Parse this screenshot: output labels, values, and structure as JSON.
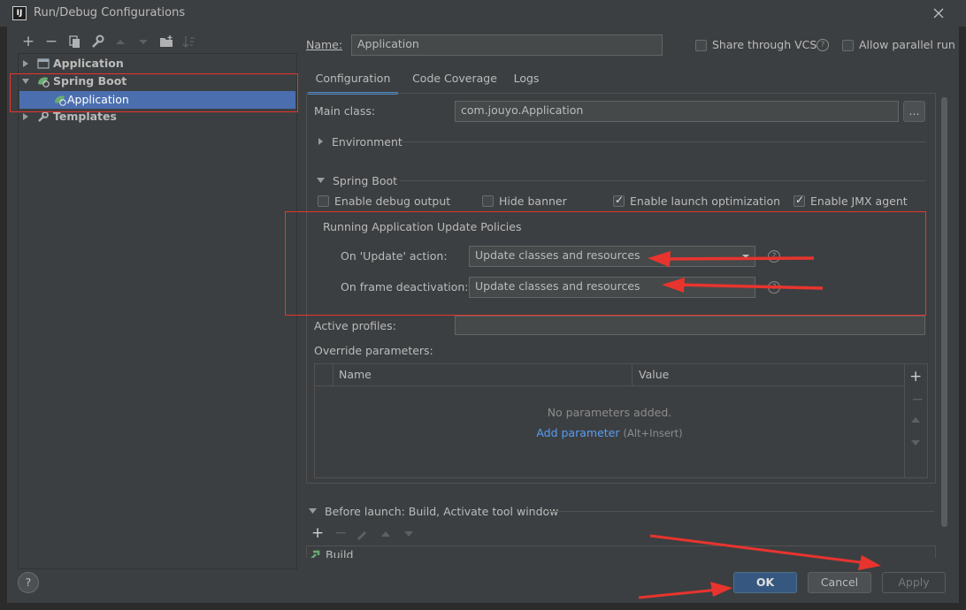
{
  "window": {
    "title": "Run/Debug Configurations",
    "app_icon_text": "IJ"
  },
  "toolbar_icons": [
    "add-icon",
    "remove-icon",
    "copy-icon",
    "wrench-icon",
    "move-up-icon",
    "move-down-icon",
    "new-folder-icon",
    "sort-icon"
  ],
  "tree": {
    "items": [
      {
        "label": "Application",
        "icon": "application-icon",
        "expanded": false
      },
      {
        "label": "Spring Boot",
        "icon": "spring-boot-icon",
        "expanded": true
      },
      {
        "label": "Application",
        "icon": "spring-boot-icon",
        "selected": true
      },
      {
        "label": "Templates",
        "icon": "wrench-icon",
        "expanded": false
      }
    ]
  },
  "header": {
    "name_label": "Name:",
    "name_value": "Application",
    "share_vcs_label": "Share through VCS",
    "allow_parallel_label": "Allow parallel run"
  },
  "tabs": [
    "Configuration",
    "Code Coverage",
    "Logs"
  ],
  "config": {
    "main_class_label": "Main class:",
    "main_class_value": "com.jouyo.Application",
    "browse_label": "...",
    "environment_label": "Environment",
    "spring_boot_label": "Spring Boot",
    "checkboxes": [
      {
        "label": "Enable debug output",
        "checked": false
      },
      {
        "label": "Hide banner",
        "checked": false
      },
      {
        "label": "Enable launch optimization",
        "checked": true
      },
      {
        "label": "Enable JMX agent",
        "checked": true
      }
    ],
    "policies_title": "Running Application Update Policies",
    "on_update_label": "On 'Update' action:",
    "on_update_value": "Update classes and resources",
    "on_frame_label": "On frame deactivation:",
    "on_frame_value": "Update classes and resources",
    "active_profiles_label": "Active profiles:",
    "active_profiles_value": "",
    "override_label": "Override parameters:",
    "table_columns": [
      "Name",
      "Value"
    ],
    "no_params_text": "No parameters added.",
    "add_param_link": "Add parameter",
    "add_param_shortcut": "(Alt+Insert)"
  },
  "before_launch": {
    "label": "Before launch: Build, Activate tool window",
    "items": [
      "Build"
    ]
  },
  "footer": {
    "help_label": "?",
    "ok_label": "OK",
    "cancel_label": "Cancel",
    "apply_label": "Apply"
  },
  "colors": {
    "background": "#3c3f41",
    "selection": "#4b6eaf",
    "annotation_red": "#e8342e",
    "link": "#589df6",
    "ok_button": "#365880"
  }
}
